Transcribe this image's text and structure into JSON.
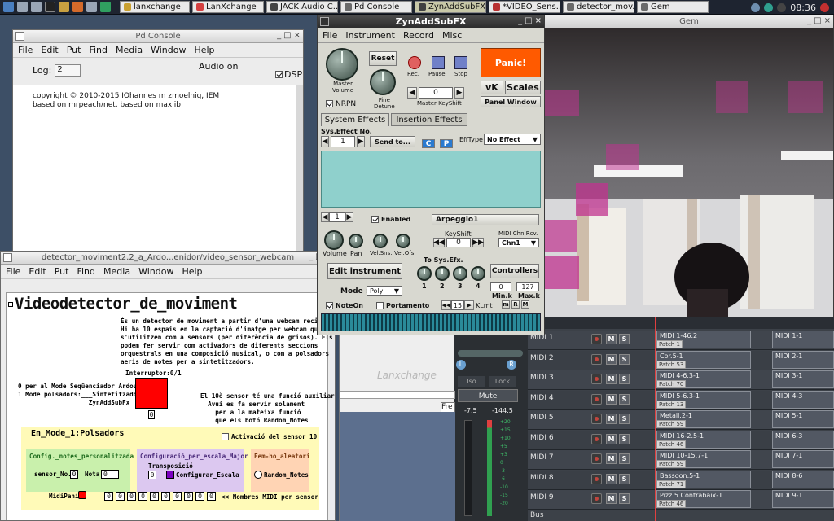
{
  "taskbar": {
    "tasks": [
      {
        "label": "lanxchange",
        "color": "#c9a030"
      },
      {
        "label": "LanXchange",
        "color": "#d44040"
      },
      {
        "label": "JACK Audio C...",
        "color": "#444444"
      },
      {
        "label": "Pd Console",
        "color": "#6a6a6a"
      },
      {
        "label": "ZynAddSubFX",
        "color": "#404040"
      },
      {
        "label": "*VIDEO_Sens...",
        "color": "#b83030"
      },
      {
        "label": "detector_mov...",
        "color": "#6a6a6a"
      },
      {
        "label": "Gem",
        "color": "#6a6a6a"
      }
    ],
    "clock": "08:36"
  },
  "pd_console": {
    "title": "Pd Console",
    "menu": [
      "File",
      "Edit",
      "Put",
      "Find",
      "Media",
      "Window",
      "Help"
    ],
    "audio_status": "Audio on",
    "log_label": "Log:",
    "log_value": "2",
    "dsp_label": "DSP",
    "lines": [
      "copyright © 2010-2015 IOhannes m zmoelnig, IEM",
      "based on mrpeach/net, based on maxlib"
    ]
  },
  "detector": {
    "title": "detector_moviment2.2_a_Ardo...enidor/video_sensor_webcam",
    "menu": [
      "File",
      "Edit",
      "Put",
      "Find",
      "Media",
      "Window",
      "Help"
    ],
    "heading": "Videodetector_de_moviment",
    "description": "És un detector de moviment a partir d'una webcam reciclada.\nHi ha 10 espais en la captació d'imatge per webcam que\ns'utilitzen com a sensors (per diferència de grisos). Els\npodem fer servir com activadors de diferents seccions\norquestrals en una composició musical, o com a polsadors\naeris de notes per a sintetitzadors.",
    "interruptor": "Interruptor:0/1",
    "mode_text": "0 per al Mode Seqüenciador Ardour\n1 Mode polsadors:___Sintetitzador\n                   ZynAddSubFx",
    "sensor10_text": "El 10è sensor té una funció auxiliar\n  Avui es fa servir solament\n    per a la mateixa funció\n    que els botó Random_Notes",
    "mode_section": "En_Mode_1:Polsadors",
    "activacio": "Activació_del_sensor_10",
    "config_notes": "Config._notes_personalitzada",
    "sensor_no": "sensor_No.",
    "nota": "Nota",
    "config_scale": "Configuració_per_escala_Major",
    "transposicio": "Transposició",
    "configurar_escala": "Configurar_Escala",
    "random_heading": "Fem-ho_aleatori",
    "random_notes": "Random_Notes",
    "midipanic": "MidiPanic",
    "midi_numbers_label": "<< Nombres MIDI per sensor",
    "zero": "0",
    "midi_numbers": [
      "0",
      "0",
      "0",
      "0",
      "0",
      "0",
      "0",
      "0",
      "0",
      "0"
    ]
  },
  "zyn": {
    "title": "ZynAddSubFX",
    "menu": [
      "File",
      "Instrument",
      "Record",
      "Misc"
    ],
    "master_volume": "Master\nVolume",
    "nrpn": "NRPN",
    "reset": "Reset",
    "fine_detune": "Fine\nDetune",
    "rec": "Rec.",
    "pause": "Pause",
    "stop": "Stop",
    "keyshift_value": "0",
    "master_keyshift": "Master KeyShift",
    "panic": "Panic!",
    "vk": "vK",
    "scales": "Scales",
    "panel_window": "Panel Window",
    "tab_system": "System Effects",
    "tab_insertion": "Insertion Effects",
    "sys_effect_no": "Sys.Effect No.",
    "effect_no_value": "1",
    "send_to": "Send to...",
    "btn_c": "C",
    "btn_p": "P",
    "efftype_label": "EffType",
    "efftype_value": "No Effect",
    "part_value": "1",
    "enabled": "Enabled",
    "instrument_name": "Arpeggio1",
    "keyshift": "KeyShift",
    "part_keyshift_value": "0",
    "midi_chn_rcv": "MIDI Chn.Rcv.",
    "midi_chn_value": "Chn1",
    "volume": "Volume",
    "pan": "Pan",
    "vel_sns": "Vel.Sns.",
    "vel_ofs": "Vel.Ofs.",
    "edit_instrument": "Edit instrument",
    "to_sys_efx": "To Sys.Efx.",
    "sys_knobs": [
      "1",
      "2",
      "3",
      "4"
    ],
    "controllers": "Controllers",
    "min_k": "Min.k",
    "max_k": "Max.k",
    "min_val": "0",
    "max_val": "127",
    "mrm": [
      "m",
      "R",
      "M"
    ],
    "mode_label": "Mode :",
    "mode_value": "Poly",
    "noteon": "NoteOn",
    "portamento": "Portamento",
    "klmt_value": "15",
    "klmt": "KLmt"
  },
  "gem": {
    "title": "Gem"
  },
  "lanx": {
    "brand": "Lanxchange",
    "field_text": "Fre"
  },
  "mixer": {
    "mute": "Mute",
    "left_db": "-7.5",
    "right_db": "-144.5",
    "iso": "Iso",
    "lock": "Lock",
    "L": "L",
    "R": "R",
    "scale": [
      "+20",
      "+15",
      "+10",
      "+5",
      "+3",
      "0",
      "-3",
      "-6",
      "-10",
      "-15",
      "-20"
    ]
  },
  "ardour": {
    "tracks": [
      {
        "name": "MIDI 1",
        "region": "MIDI 1-46.2",
        "patch": "Patch 1",
        "region2": "MIDI 1-1"
      },
      {
        "name": "MIDI 2",
        "region": "Cor.5-1",
        "patch": "Patch 53",
        "region2": "MIDI 2-1"
      },
      {
        "name": "MIDI 3",
        "region": "MIDI 4-6.3-1",
        "patch": "Patch 70",
        "region2": "MIDI 3-1"
      },
      {
        "name": "MIDI 4",
        "region": "MIDI 5-6.3-1",
        "patch": "Patch 13",
        "region2": "MIDI 4-3"
      },
      {
        "name": "MIDI 5",
        "region": "Metall.2-1",
        "patch": "Patch 59",
        "region2": "MIDI 5-1"
      },
      {
        "name": "MIDI 6",
        "region": "MIDI 16-2.5-1",
        "patch": "Patch 46",
        "region2": "MIDI 6-3"
      },
      {
        "name": "MIDI 7",
        "region": "MIDI 10-15.7-1",
        "patch": "Patch 59",
        "region2": "MIDI 7-1"
      },
      {
        "name": "MIDI 8",
        "region": "Bassoon.5-1",
        "patch": "Patch 71",
        "region2": "MIDI 8-6"
      },
      {
        "name": "MIDI 9",
        "region": "Pizz.5 Contrabaix-1",
        "patch": "Patch 46",
        "region2": "MIDI 9-1"
      }
    ],
    "m": "M",
    "s": "S",
    "bus": "Bus"
  }
}
